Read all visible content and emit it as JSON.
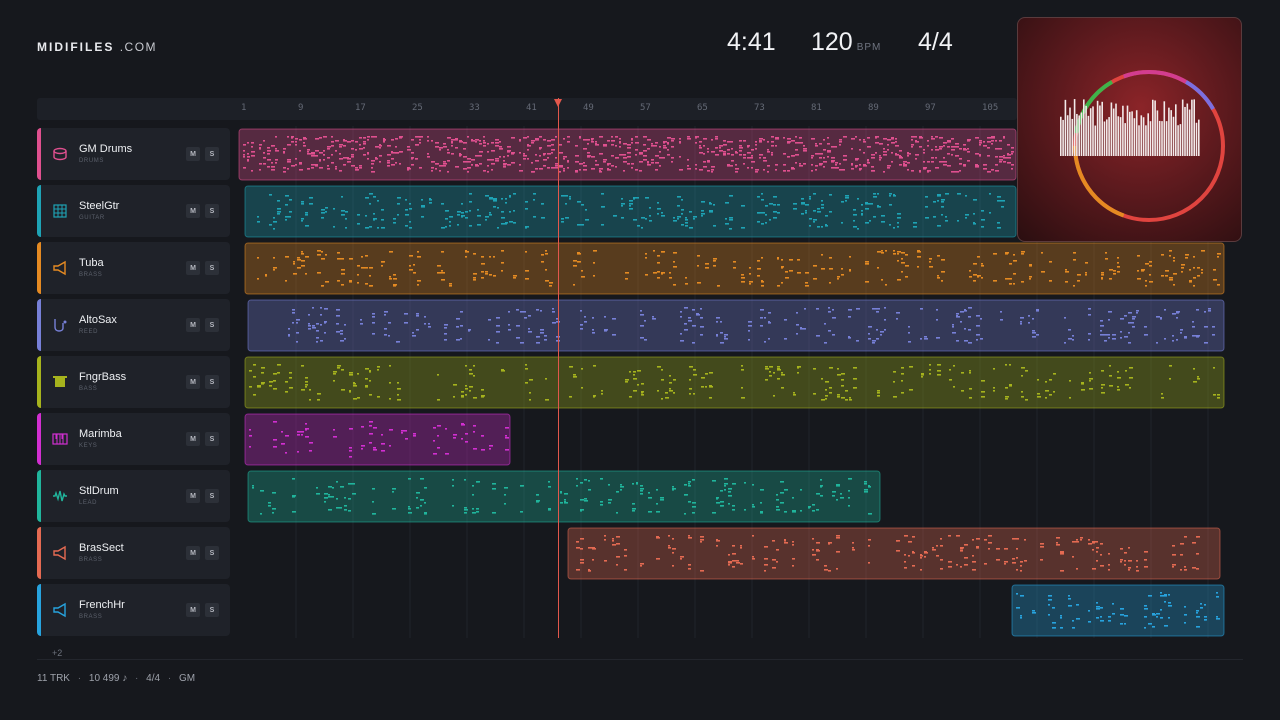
{
  "brand": {
    "name": "MIDIFILES",
    "domain": ".COM"
  },
  "transport": {
    "time": "4:41",
    "tempo": "120",
    "tempo_unit": "BPM",
    "signature": "4/4"
  },
  "ruler": {
    "ticks": [
      "1",
      "9",
      "17",
      "25",
      "33",
      "41",
      "49",
      "57",
      "65",
      "73",
      "81",
      "89",
      "97",
      "105"
    ]
  },
  "playhead_bar": 44,
  "tracks": [
    {
      "name": "GM Drums",
      "category": "DRUMS",
      "color": "#e0508f",
      "icon": "drum-icon",
      "mute": "M",
      "solo": "S"
    },
    {
      "name": "SteelGtr",
      "category": "GUITAR",
      "color": "#1ea3b5",
      "icon": "guitar-icon",
      "mute": "M",
      "solo": "S"
    },
    {
      "name": "Tuba",
      "category": "BRASS",
      "color": "#e58a22",
      "icon": "horn-icon",
      "mute": "M",
      "solo": "S"
    },
    {
      "name": "AltoSax",
      "category": "REED",
      "color": "#7780d8",
      "icon": "sax-icon",
      "mute": "M",
      "solo": "S"
    },
    {
      "name": "FngrBass",
      "category": "BASS",
      "color": "#a6b31d",
      "icon": "bass-icon",
      "mute": "M",
      "solo": "S"
    },
    {
      "name": "Marimba",
      "category": "KEYS",
      "color": "#d22fd1",
      "icon": "keys-icon",
      "mute": "M",
      "solo": "S"
    },
    {
      "name": "StlDrum",
      "category": "LEAD",
      "color": "#20b59c",
      "icon": "wave-icon",
      "mute": "M",
      "solo": "S"
    },
    {
      "name": "BrasSect",
      "category": "BRASS",
      "color": "#e56a52",
      "icon": "horn-icon",
      "mute": "M",
      "solo": "S"
    },
    {
      "name": "FrenchHr",
      "category": "BRASS",
      "color": "#27a3de",
      "icon": "horn-icon",
      "mute": "M",
      "solo": "S"
    }
  ],
  "more_tracks": "+2",
  "footer": {
    "tracks": "11 TRK",
    "notes": "10 499 ♪",
    "signature": "4/4",
    "standard": "GM",
    "separator": "·"
  }
}
